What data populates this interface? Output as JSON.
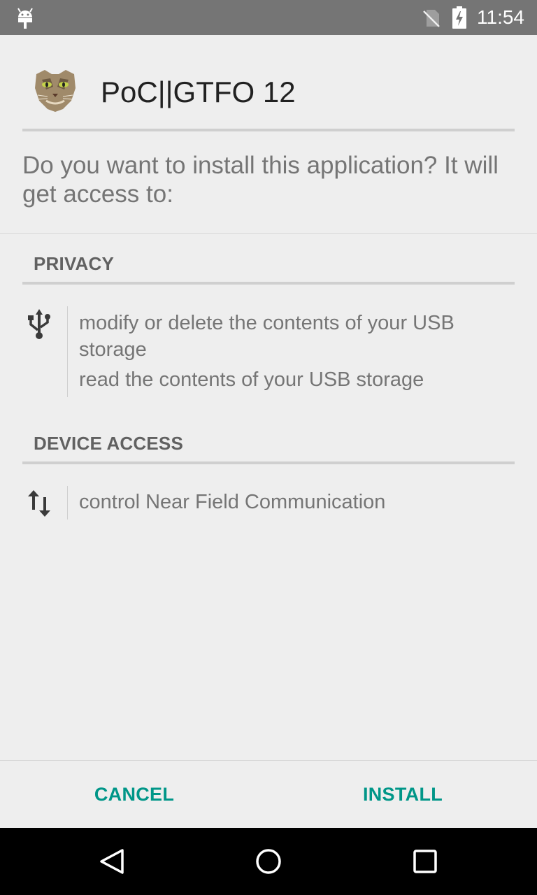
{
  "status_bar": {
    "time": "11:54",
    "icons": [
      "android-icon",
      "no-sim-icon",
      "battery-charging-icon"
    ]
  },
  "header": {
    "app_name": "PoC||GTFO 12",
    "app_icon": "cat-face-app-icon"
  },
  "prompt": "Do you want to install this application? It will get access to:",
  "sections": [
    {
      "title": "PRIVACY",
      "icon": "usb-icon",
      "permissions": [
        "modify or delete the contents of your USB storage",
        "read the contents of your USB storage"
      ]
    },
    {
      "title": "DEVICE ACCESS",
      "icon": "nfc-arrows-icon",
      "permissions": [
        "control Near Field Communication"
      ]
    }
  ],
  "actions": {
    "cancel_label": "CANCEL",
    "install_label": "INSTALL"
  },
  "nav_bar": {
    "icons": [
      "back-icon",
      "home-icon",
      "recents-icon"
    ]
  },
  "colors": {
    "status_bar": "#757575",
    "background": "#eeeeee",
    "accent": "#009688",
    "nav_bar": "#000000"
  }
}
